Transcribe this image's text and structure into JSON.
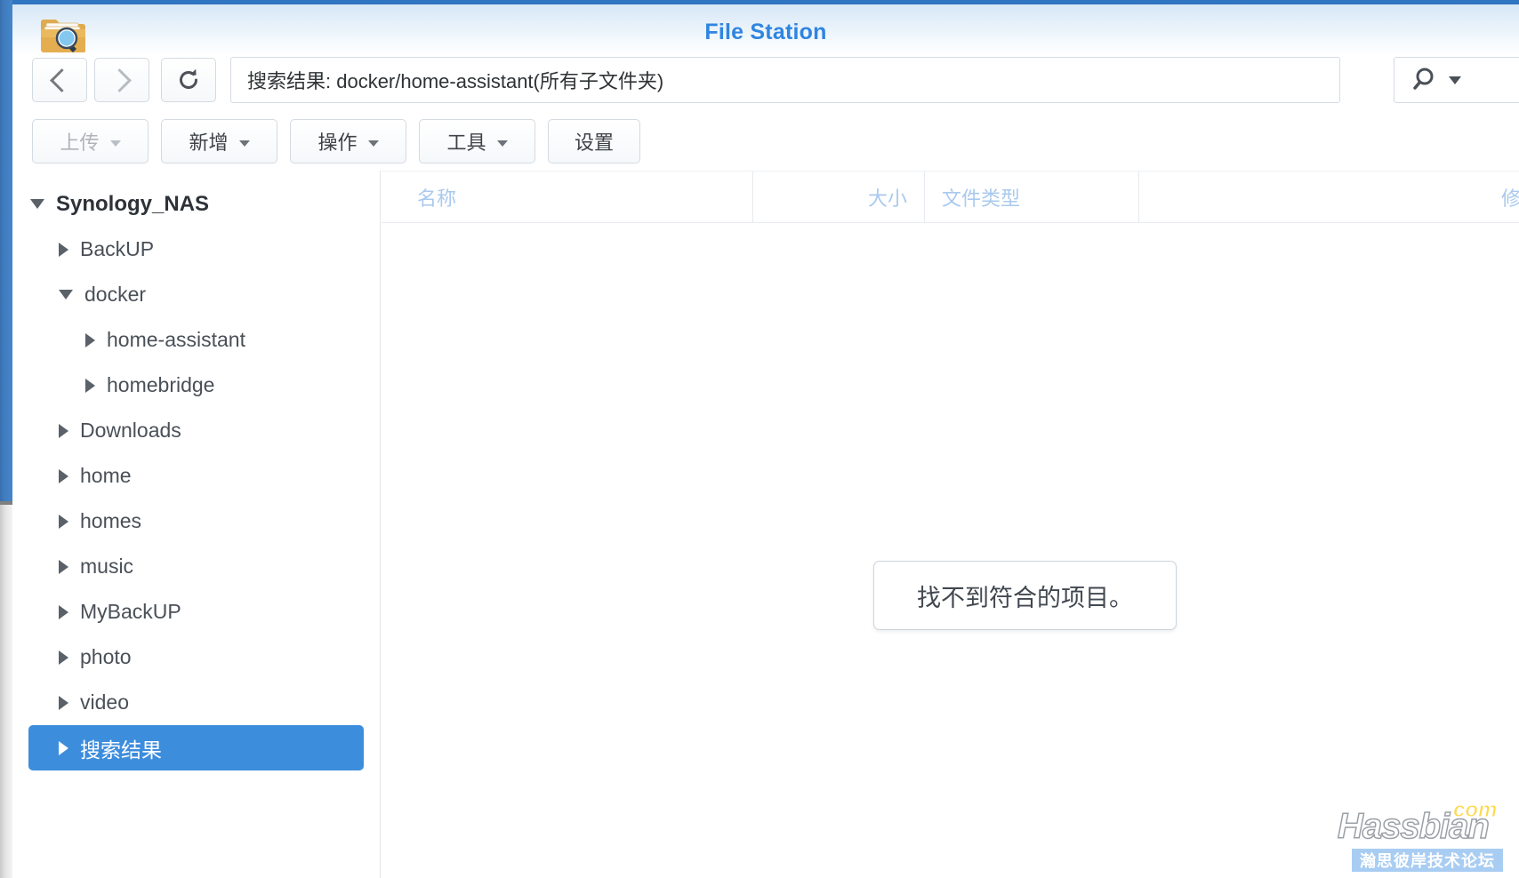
{
  "window": {
    "title": "File Station",
    "app_icon": "folder-search-icon",
    "accent_color": "#2f85e0",
    "titlebar_border_color": "#2f74c0"
  },
  "nav": {
    "back_icon": "chevron-left-icon",
    "forward_icon": "chevron-right-icon",
    "reload_icon": "refresh-icon",
    "path_value": "搜索结果: docker/home-assistant(所有子文件夹)",
    "path_placeholder": "搜索结果: docker/home-assistant(所有子文件夹)",
    "search_icon": "search-icon",
    "search_caret_icon": "chevron-down-icon"
  },
  "toolbar": {
    "buttons": [
      {
        "label": "上传",
        "has_caret": true,
        "disabled": true,
        "name": "upload-button"
      },
      {
        "label": "新增",
        "has_caret": true,
        "disabled": false,
        "name": "new-button"
      },
      {
        "label": "操作",
        "has_caret": true,
        "disabled": false,
        "name": "action-button"
      },
      {
        "label": "工具",
        "has_caret": true,
        "disabled": false,
        "name": "tools-button"
      },
      {
        "label": "设置",
        "has_caret": false,
        "disabled": false,
        "name": "settings-button"
      }
    ]
  },
  "sidebar": {
    "selected_color": "#3d8ddd",
    "items": [
      {
        "label": "Synology_NAS",
        "level": 0,
        "state": "open",
        "selected": false
      },
      {
        "label": "BackUP",
        "level": 1,
        "state": "closed",
        "selected": false
      },
      {
        "label": "docker",
        "level": 1,
        "state": "open",
        "selected": false
      },
      {
        "label": "home-assistant",
        "level": 2,
        "state": "closed",
        "selected": false
      },
      {
        "label": "homebridge",
        "level": 2,
        "state": "closed",
        "selected": false
      },
      {
        "label": "Downloads",
        "level": 1,
        "state": "closed",
        "selected": false
      },
      {
        "label": "home",
        "level": 1,
        "state": "closed",
        "selected": false
      },
      {
        "label": "homes",
        "level": 1,
        "state": "closed",
        "selected": false
      },
      {
        "label": "music",
        "level": 1,
        "state": "closed",
        "selected": false
      },
      {
        "label": "MyBackUP",
        "level": 1,
        "state": "closed",
        "selected": false
      },
      {
        "label": "photo",
        "level": 1,
        "state": "closed",
        "selected": false
      },
      {
        "label": "video",
        "level": 1,
        "state": "closed",
        "selected": false
      },
      {
        "label": "搜索结果",
        "level": 1,
        "state": "closed",
        "selected": true
      }
    ]
  },
  "file_list": {
    "columns": [
      {
        "label": "名称",
        "align": "left",
        "name": "column-header-name"
      },
      {
        "label": "大小",
        "align": "right",
        "name": "column-header-size"
      },
      {
        "label": "文件类型",
        "align": "left",
        "name": "column-header-filetype"
      },
      {
        "label": "修改",
        "align": "right",
        "name": "column-header-modified"
      }
    ],
    "rows": [],
    "empty_message": "找不到符合的项目。"
  },
  "watermark": {
    "brand": "Hassbian",
    "tld": "com",
    "subtitle": "瀚思彼岸技术论坛"
  }
}
